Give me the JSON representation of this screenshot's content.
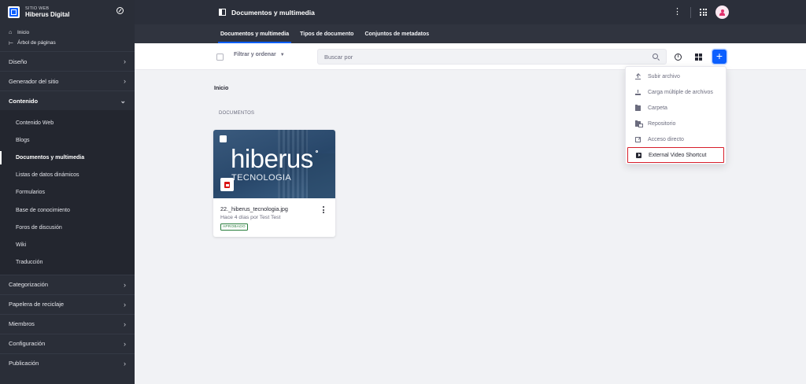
{
  "sidebar": {
    "site_label": "SITIO WEB",
    "site_name": "Hiberus Digital",
    "top_links": [
      {
        "label": "Inicio",
        "icon": "home-icon"
      },
      {
        "label": "Árbol de páginas",
        "icon": "page-tree-icon"
      }
    ],
    "sections_before": [
      {
        "label": "Diseño"
      },
      {
        "label": "Generador del sitio"
      }
    ],
    "open_section": {
      "label": "Contenido"
    },
    "subitems": [
      {
        "label": "Contenido Web"
      },
      {
        "label": "Blogs"
      },
      {
        "label": "Documentos y multimedia",
        "active": true
      },
      {
        "label": "Listas de datos dinámicos"
      },
      {
        "label": "Formularios"
      },
      {
        "label": "Base de conocimiento"
      },
      {
        "label": "Foros de discusión"
      },
      {
        "label": "Wiki"
      },
      {
        "label": "Traducción"
      }
    ],
    "sections_after": [
      {
        "label": "Categorización"
      },
      {
        "label": "Papelera de reciclaje"
      },
      {
        "label": "Miembros"
      },
      {
        "label": "Configuración"
      },
      {
        "label": "Publicación"
      }
    ]
  },
  "header": {
    "title": "Documentos y multimedia"
  },
  "tabs": [
    {
      "label": "Documentos y multimedia",
      "active": true
    },
    {
      "label": "Tipos de documento"
    },
    {
      "label": "Conjuntos de metadatos"
    }
  ],
  "toolbar": {
    "filter_label": "Filtrar y ordenar",
    "search_placeholder": "Buscar por",
    "add_symbol": "+",
    "info_symbol": "i"
  },
  "main": {
    "breadcrumb": "Inicio",
    "section_label": "DOCUMENTOS",
    "card": {
      "image_brand": "hiberus",
      "image_tagline": "TECNOLOGIA",
      "name": "22._hiberus_tecnologia.jpg",
      "meta": "Hace 4 días por Test Test",
      "status": "APROBADO"
    }
  },
  "dropdown": {
    "items": [
      {
        "label": "Subir archivo",
        "icon": "upload-icon"
      },
      {
        "label": "Carga múltiple de archivos",
        "icon": "multiple-upload-icon"
      },
      {
        "label": "Carpeta",
        "icon": "folder-icon"
      },
      {
        "label": "Repositorio",
        "icon": "repository-icon"
      },
      {
        "label": "Acceso directo",
        "icon": "shortcut-icon"
      },
      {
        "label": "External Video Shortcut",
        "icon": "video-icon",
        "highlighted": true
      }
    ]
  },
  "colors": {
    "sidebar_bg": "#2a2e38",
    "accent": "#0b5fff",
    "highlight_border": "#d71f2b",
    "approved": "#287d3c"
  }
}
